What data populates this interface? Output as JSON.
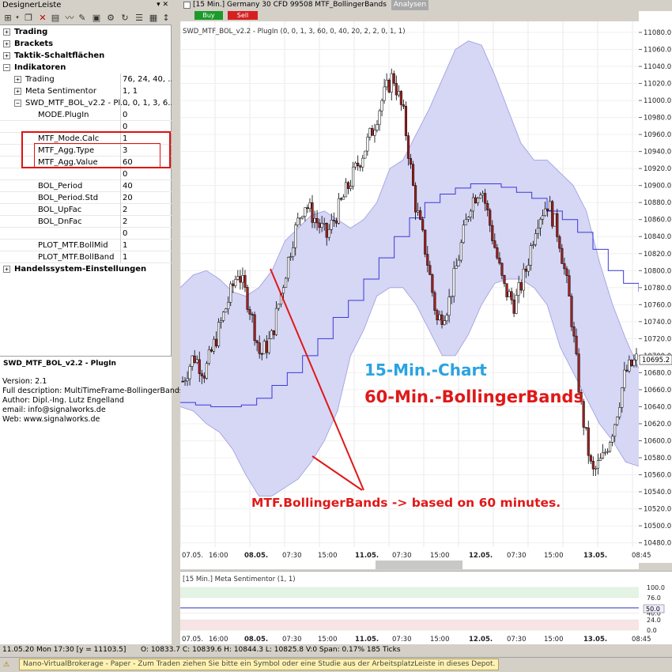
{
  "left_panel": {
    "title": "DesignerLeiste",
    "pin_icon": "📌",
    "tree": [
      {
        "label": "Trading",
        "value": "",
        "level": 0,
        "bold": true,
        "exp": "+"
      },
      {
        "label": "Brackets",
        "value": "",
        "level": 0,
        "bold": true,
        "exp": "+"
      },
      {
        "label": "Taktik-Schaltflächen",
        "value": "",
        "level": 0,
        "bold": true,
        "exp": "+"
      },
      {
        "label": "Indikatoren",
        "value": "",
        "level": 0,
        "bold": true,
        "exp": "−"
      },
      {
        "label": "Trading",
        "value": "76, 24, 40, ...",
        "level": 1,
        "bold": false,
        "exp": "+"
      },
      {
        "label": "Meta Sentimentor",
        "value": "1, 1",
        "level": 1,
        "bold": false,
        "exp": "+"
      },
      {
        "label": "SWD_MTF_BOL_v2.2 - Pl...",
        "value": "0, 0, 1, 3, 6...",
        "level": 1,
        "bold": false,
        "exp": "−"
      },
      {
        "label": "MODE.PlugIn",
        "value": "0",
        "level": 2,
        "bold": false,
        "exp": ""
      },
      {
        "label": "",
        "value": "0",
        "level": 2,
        "bold": false,
        "exp": ""
      },
      {
        "label": "MTF_Mode.Calc",
        "value": "1",
        "level": 2,
        "bold": false,
        "exp": ""
      },
      {
        "label": "MTF_Agg.Type",
        "value": "3",
        "level": 2,
        "bold": false,
        "exp": ""
      },
      {
        "label": "MTF_Agg.Value",
        "value": "60",
        "level": 2,
        "bold": false,
        "exp": ""
      },
      {
        "label": "",
        "value": "0",
        "level": 2,
        "bold": false,
        "exp": ""
      },
      {
        "label": "BOL_Period",
        "value": "40",
        "level": 2,
        "bold": false,
        "exp": ""
      },
      {
        "label": "BOL_Period.Std",
        "value": "20",
        "level": 2,
        "bold": false,
        "exp": ""
      },
      {
        "label": "BOL_UpFac",
        "value": "2",
        "level": 2,
        "bold": false,
        "exp": ""
      },
      {
        "label": "BOL_DnFac",
        "value": "2",
        "level": 2,
        "bold": false,
        "exp": ""
      },
      {
        "label": "",
        "value": "0",
        "level": 2,
        "bold": false,
        "exp": ""
      },
      {
        "label": "PLOT_MTF.BollMid",
        "value": "1",
        "level": 2,
        "bold": false,
        "exp": ""
      },
      {
        "label": "PLOT_MTF.BollBand",
        "value": "1",
        "level": 2,
        "bold": false,
        "exp": ""
      },
      {
        "label": "Handelssystem-Einstellungen",
        "value": "",
        "level": 0,
        "bold": true,
        "exp": "+"
      }
    ],
    "description": {
      "title": "SWD_MTF_BOL_v2.2 - PlugIn",
      "lines": [
        "Version: 2.1",
        "Full description: MultiTimeFrame-BollingerBands",
        "Author: Dipl.-Ing. Lutz Engelland",
        "email: info@signalworks.de",
        "Web: www.signalworks.de"
      ]
    }
  },
  "chart_header": {
    "text": "[15 Min.] Germany 30 CFD   99508 MTF_BollingerBands",
    "analysen": "Analysen",
    "buy": "Buy",
    "sell": "Sell"
  },
  "chart_data": [
    {
      "type": "line",
      "legend": "SWD_MTF_BOL_v2.2 - PlugIn  (0, 0, 1, 3, 60, 0, 40, 20, 2, 2, 0, 1, 1)",
      "y_ticks": [
        11080,
        11060,
        11040,
        11020,
        11000,
        10980,
        10960,
        10940,
        10920,
        10900,
        10880,
        10860,
        10840,
        10820,
        10800,
        10780,
        10760,
        10740,
        10720,
        10700,
        10680,
        10660,
        10640,
        10620,
        10600,
        10580,
        10560,
        10540,
        10520,
        10500,
        10480
      ],
      "ylim": [
        10475,
        11093
      ],
      "x_ticks": [
        "07.05.",
        "16:00",
        "08.05.",
        "07:30",
        "15:00",
        "11.05.",
        "07:30",
        "15:00",
        "12.05.",
        "07:30",
        "15:00",
        "13.05.",
        "08:45"
      ],
      "bold_x_ticks": [
        "08.05.",
        "11.05.",
        "12.05.",
        "13.05."
      ],
      "last_price": "10695.2",
      "upper_band": [
        10780,
        10795,
        10800,
        10790,
        10775,
        10770,
        10780,
        10800,
        10835,
        10850,
        10865,
        10870,
        10860,
        10850,
        10860,
        10880,
        10920,
        10930,
        10960,
        10990,
        11025,
        11060,
        11070,
        11065,
        11030,
        10990,
        10950,
        10930,
        10930,
        10915,
        10900,
        10870,
        10810,
        10760,
        10720,
        10685
      ],
      "lower_band": [
        10640,
        10635,
        10620,
        10610,
        10590,
        10560,
        10535,
        10535,
        10545,
        10555,
        10575,
        10600,
        10635,
        10700,
        10730,
        10770,
        10780,
        10780,
        10760,
        10730,
        10700,
        10700,
        10725,
        10760,
        10785,
        10790,
        10790,
        10780,
        10760,
        10710,
        10680,
        10650,
        10620,
        10600,
        10575,
        10570
      ],
      "middle_band": [
        10645,
        10642,
        10640,
        10640,
        10642,
        10650,
        10665,
        10680,
        10700,
        10720,
        10745,
        10765,
        10790,
        10815,
        10840,
        10862,
        10880,
        10890,
        10897,
        10902,
        10902,
        10898,
        10892,
        10885,
        10870,
        10860,
        10845,
        10825,
        10800,
        10785,
        10775
      ],
      "close": [
        10670,
        10700,
        10680,
        10720,
        10760,
        10800,
        10760,
        10700,
        10720,
        10780,
        10840,
        10880,
        10860,
        10840,
        10870,
        10900,
        10930,
        10960,
        11000,
        11030,
        10980,
        10880,
        10820,
        10740,
        10760,
        10820,
        10880,
        10900,
        10840,
        10780,
        10760,
        10800,
        10860,
        10880,
        10840,
        10760,
        10640,
        10560,
        10580,
        10620,
        10680,
        10695
      ]
    },
    {
      "type": "line",
      "legend": "[15 Min.] Meta Sentimentor  (1, 1)",
      "y_ticks": [
        100.0,
        76.0,
        50.0,
        40.0,
        24.0,
        0.0
      ],
      "ylim": [
        0,
        100
      ],
      "current_value": "50.0",
      "values": [
        52,
        52,
        52,
        52,
        52,
        52,
        52,
        52,
        52,
        52,
        52
      ]
    }
  ],
  "annotations": {
    "line1": "15-Min.-Chart",
    "line2": "60-Min.-BollingerBands",
    "arrow_text": "MTF.BollingerBands -> based on 60 minutes."
  },
  "status_bar": {
    "datetime": "11.05.20 Mon   17:30 [y = 11103.5]",
    "ohlc": "O: 10833.7 C: 10839.6 H: 10844.3 L: 10825.8 V:0 Span: 0.17% 185 Ticks"
  },
  "bottom_bar": {
    "message": "Nano-VirtualBrokerage - Paper - Zum Traden ziehen Sie bitte ein Symbol oder eine Studie aus der ArbeitsplatzLeiste in dieses Depot."
  },
  "colors": {
    "band_fill": "#d6d6f5",
    "band_line": "#9c9ce0",
    "mid_line": "#3a3ad8",
    "candle_up": "#ffffff",
    "candle_down": "#a02020",
    "annotation_blue": "#2aa3e0",
    "annotation_red": "#e01818"
  }
}
